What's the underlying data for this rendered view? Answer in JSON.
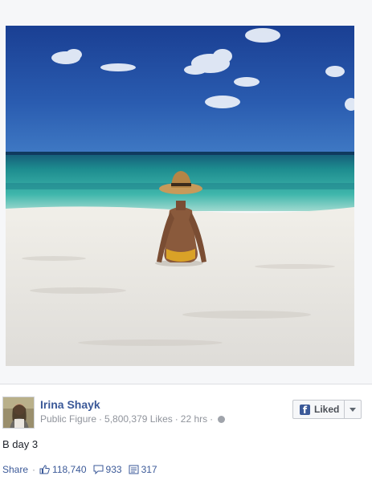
{
  "post": {
    "author": "Irina Shayk",
    "category": "Public Figure",
    "likes_count": "5,800,379 Likes",
    "time": "22 hrs",
    "text": "B day 3"
  },
  "liked_button": {
    "label": "Liked",
    "icon": "facebook-f-icon"
  },
  "footer": {
    "share_label": "Share",
    "likes": "118,740",
    "comments": "933",
    "shares": "317"
  },
  "colors": {
    "link_blue": "#3b5998",
    "meta_gray": "#90949c"
  }
}
